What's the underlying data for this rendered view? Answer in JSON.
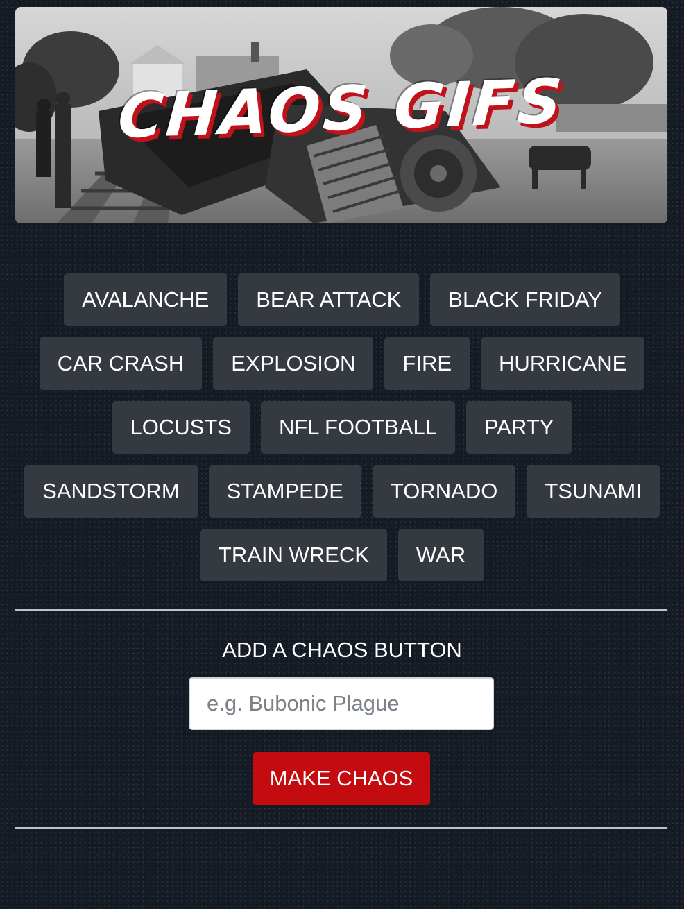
{
  "header": {
    "title": "CHAOS GIFS"
  },
  "chaos_buttons": [
    {
      "label": "AVALANCHE"
    },
    {
      "label": "BEAR ATTACK"
    },
    {
      "label": "BLACK FRIDAY"
    },
    {
      "label": "CAR CRASH"
    },
    {
      "label": "EXPLOSION"
    },
    {
      "label": "FIRE"
    },
    {
      "label": "HURRICANE"
    },
    {
      "label": "LOCUSTS"
    },
    {
      "label": "NFL FOOTBALL"
    },
    {
      "label": "PARTY"
    },
    {
      "label": "SANDSTORM"
    },
    {
      "label": "STAMPEDE"
    },
    {
      "label": "TORNADO"
    },
    {
      "label": "TSUNAMI"
    },
    {
      "label": "TRAIN WRECK"
    },
    {
      "label": "WAR"
    }
  ],
  "add_form": {
    "label": "ADD A CHAOS BUTTON",
    "input_placeholder": "e.g. Bubonic Plague",
    "input_value": "",
    "submit_label": "MAKE CHAOS"
  },
  "colors": {
    "background": "#161c26",
    "button": "#343a40",
    "accent": "#c30b10"
  }
}
